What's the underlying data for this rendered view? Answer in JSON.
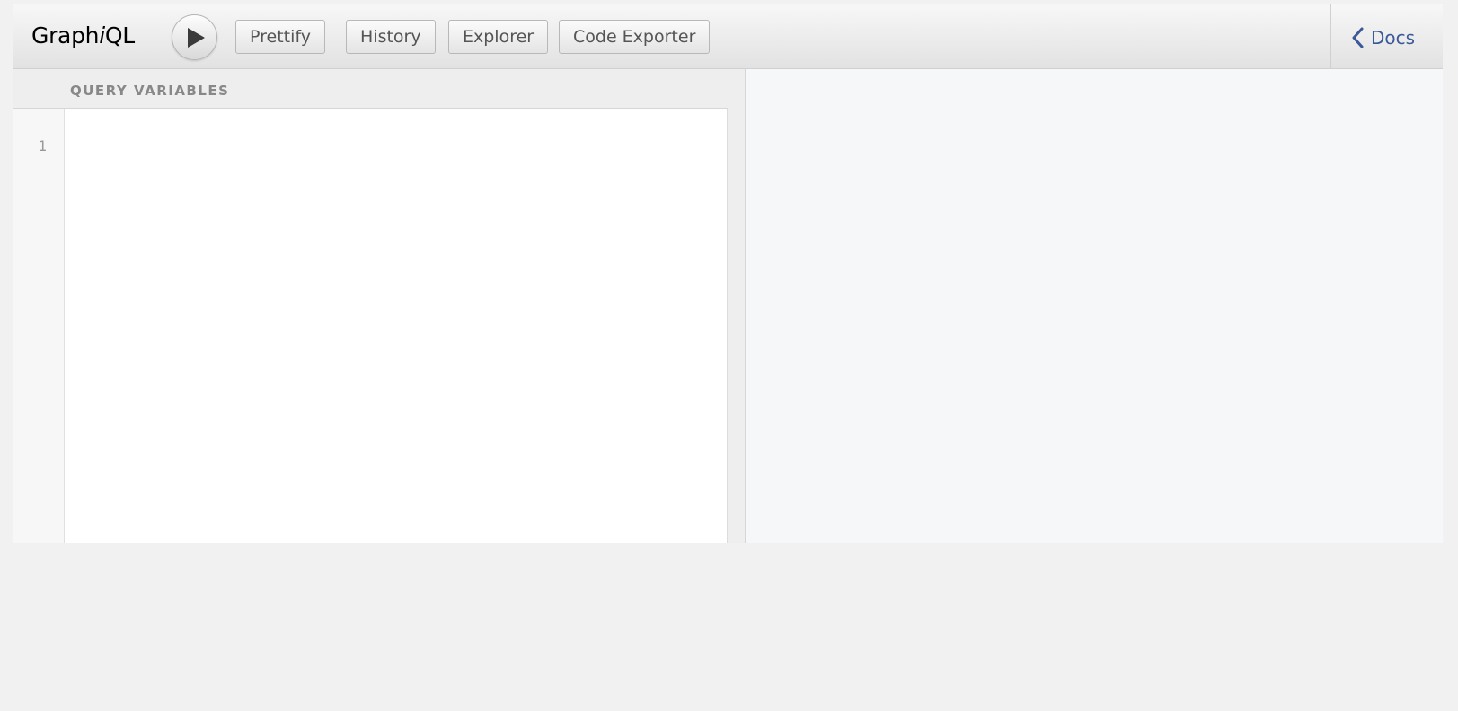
{
  "toolbar": {
    "logo_prefix": "Graph",
    "logo_italic": "i",
    "logo_suffix": "QL",
    "run_icon": "play-icon",
    "buttons": {
      "prettify": "Prettify",
      "history": "History",
      "explorer": "Explorer",
      "code_exporter": "Code Exporter"
    },
    "docs_label": "Docs",
    "docs_icon": "chevron-left-icon"
  },
  "variables": {
    "title": "QUERY VARIABLES",
    "line_numbers": [
      "1"
    ],
    "content": ""
  },
  "result": {
    "content": ""
  },
  "colors": {
    "docs_link": "#3b5998",
    "toolbar_bg": "#ececec",
    "result_bg": "#f6f7f8"
  }
}
